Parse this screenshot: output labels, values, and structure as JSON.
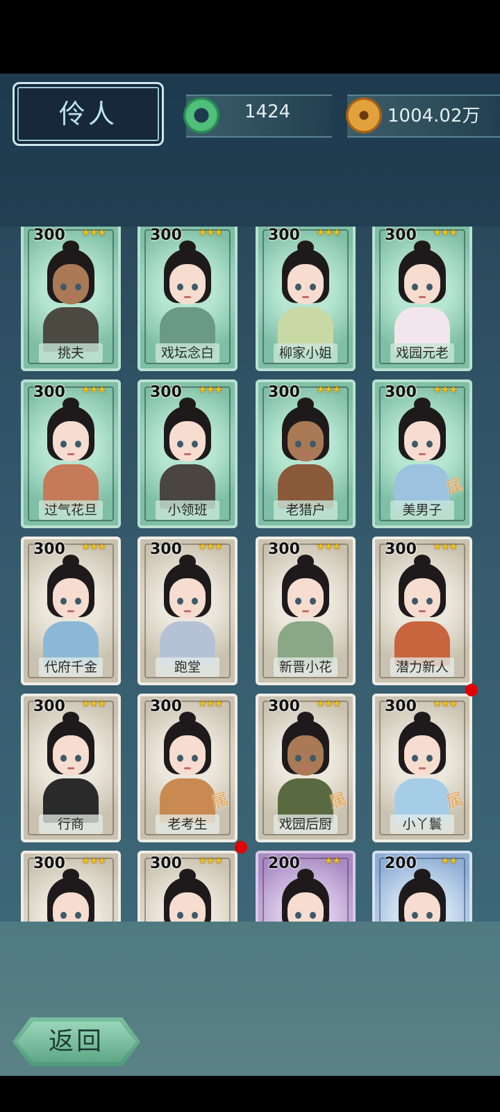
{
  "header": {
    "title": "伶人",
    "jade_amount": "1424",
    "coin_amount": "1004.02万"
  },
  "cards": [
    {
      "cost": "300",
      "stars": "★★★",
      "name": "挑夫",
      "theme": "green",
      "skin": "dark",
      "robe": "#4a4a40",
      "tag": ""
    },
    {
      "cost": "300",
      "stars": "★★★",
      "name": "戏坛念白",
      "theme": "green",
      "skin": "light",
      "robe": "#6a9a86",
      "tag": ""
    },
    {
      "cost": "300",
      "stars": "★★★",
      "name": "柳家小姐",
      "theme": "green",
      "skin": "light",
      "robe": "#c9d9a6",
      "tag": ""
    },
    {
      "cost": "300",
      "stars": "★★★",
      "name": "戏园元老",
      "theme": "green",
      "skin": "light",
      "robe": "#f2e6ec",
      "tag": ""
    },
    {
      "cost": "300",
      "stars": "★★★",
      "name": "过气花旦",
      "theme": "green",
      "skin": "light",
      "robe": "#c77a5a",
      "tag": ""
    },
    {
      "cost": "300",
      "stars": "★★★",
      "name": "小领班",
      "theme": "green",
      "skin": "light",
      "robe": "#4a4540",
      "tag": ""
    },
    {
      "cost": "300",
      "stars": "★★★",
      "name": "老猎户",
      "theme": "green",
      "skin": "dark",
      "robe": "#8a5a3a",
      "tag": ""
    },
    {
      "cost": "300",
      "stars": "★★★",
      "name": "美男子",
      "theme": "green",
      "skin": "light",
      "robe": "#9cc2e0",
      "tag": "属"
    },
    {
      "cost": "300",
      "stars": "★★★",
      "name": "代府千金",
      "theme": "beige",
      "skin": "light",
      "robe": "#8bb8d6",
      "tag": ""
    },
    {
      "cost": "300",
      "stars": "★★★",
      "name": "跑堂",
      "theme": "beige",
      "skin": "light",
      "robe": "#b5c2d6",
      "tag": ""
    },
    {
      "cost": "300",
      "stars": "★★★",
      "name": "新晋小花",
      "theme": "beige",
      "skin": "light",
      "robe": "#8aa886",
      "tag": ""
    },
    {
      "cost": "300",
      "stars": "★★★",
      "name": "潜力新人",
      "theme": "beige",
      "skin": "light",
      "robe": "#c8643e",
      "tag": ""
    },
    {
      "cost": "300",
      "stars": "★★★",
      "name": "行商",
      "theme": "beige",
      "skin": "light",
      "robe": "#2a2a2a",
      "tag": ""
    },
    {
      "cost": "300",
      "stars": "★★★",
      "name": "老考生",
      "theme": "beige",
      "skin": "light",
      "robe": "#c98a52",
      "tag": "属"
    },
    {
      "cost": "300",
      "stars": "★★★",
      "name": "戏园后厨",
      "theme": "beige",
      "skin": "dark",
      "robe": "#5a6a40",
      "tag": "属"
    },
    {
      "cost": "300",
      "stars": "★★★",
      "name": "小丫鬟",
      "theme": "beige",
      "skin": "light",
      "robe": "#a6cde8",
      "tag": "属"
    },
    {
      "cost": "300",
      "stars": "★★★",
      "name": "",
      "theme": "beige",
      "skin": "light",
      "robe": "#7a3a3a",
      "tag": ""
    },
    {
      "cost": "300",
      "stars": "★★★",
      "name": "",
      "theme": "beige",
      "skin": "light",
      "robe": "#3a3a3a",
      "tag": ""
    },
    {
      "cost": "200",
      "stars": "★★",
      "name": "",
      "theme": "purple",
      "skin": "light",
      "robe": "#6a4a7a",
      "tag": ""
    },
    {
      "cost": "200",
      "stars": "★★",
      "name": "",
      "theme": "blue",
      "skin": "light",
      "robe": "#4a6a8a",
      "tag": ""
    }
  ],
  "footer": {
    "back_label": "返回"
  },
  "colors": {
    "header_bg": "#1d3a4e",
    "grid_bg": "#355b6d",
    "notification_dot": "#e30000"
  }
}
